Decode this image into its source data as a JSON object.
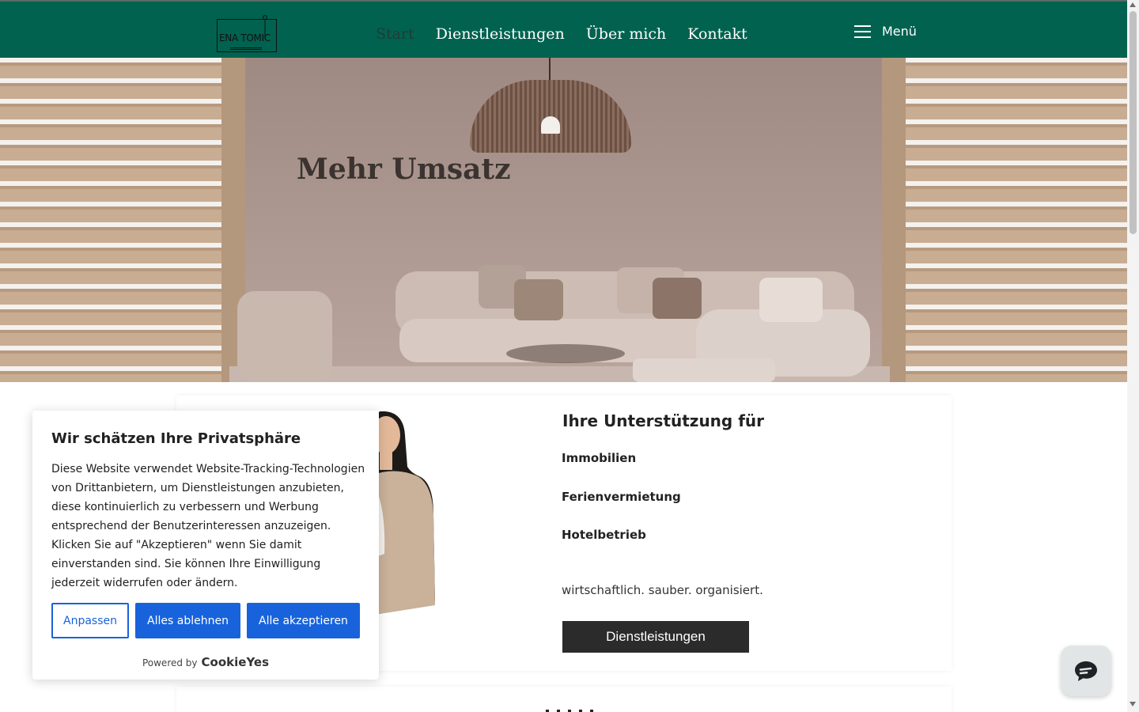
{
  "header": {
    "logo_text": "ENA TOMIC",
    "nav": [
      {
        "label": "Start",
        "active": true
      },
      {
        "label": "Dienstleistungen",
        "active": false
      },
      {
        "label": "Über mich",
        "active": false
      },
      {
        "label": "Kontakt",
        "active": false
      }
    ],
    "menu_label": "Menü",
    "menu_icon": "hamburger-icon",
    "background_color": "#00624f"
  },
  "hero": {
    "title": "Mehr Umsatz."
  },
  "services_card": {
    "heading": "Ihre Unterstützung für",
    "items": [
      "Immobilien",
      "Ferienvermietung",
      "Hotelbetrieb"
    ],
    "tagline": "wirtschaftlich. sauber. organisiert.",
    "button_label": "Dienstleistungen"
  },
  "cookie_banner": {
    "title": "Wir schätzen Ihre Privatsphäre",
    "text": "Diese Website verwendet Website-Tracking-Technologien von Drittanbietern, um Dienstleistungen anzubieten, diese kontinuierlich zu verbessern und Werbung entsprechend der Benutzerinteressen anzuzeigen. Klicken Sie auf \"Akzeptieren\" wenn Sie damit einverstanden sind. Sie können Ihre Einwilligung jederzeit widerrufen oder ändern.",
    "buttons": {
      "customize": "Anpassen",
      "reject_all": "Alles ablehnen",
      "accept_all": "Alle akzeptieren"
    },
    "powered_by": "Powered by",
    "brand": "CookieYes",
    "accent_color": "#1863dc"
  },
  "chat_widget": {
    "icon": "chat-bubble-icon"
  }
}
